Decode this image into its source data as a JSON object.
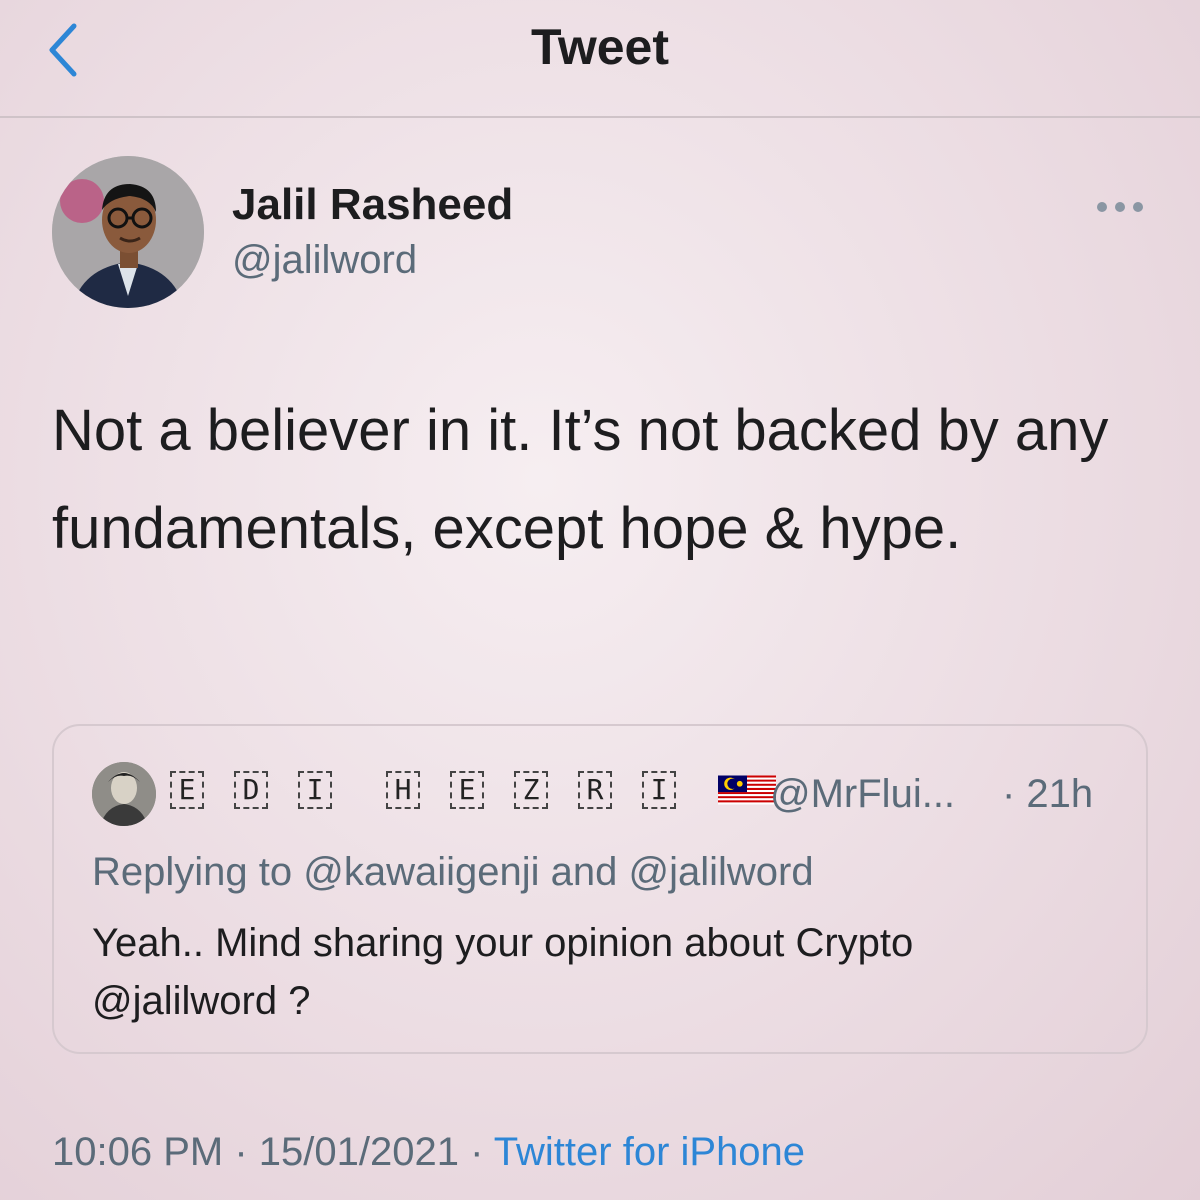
{
  "nav": {
    "title": "Tweet",
    "back_icon": "chevron-left-icon"
  },
  "tweet": {
    "author_name": "Jalil Rasheed",
    "author_handle": "@jalilword",
    "more_icon": "ellipsis-icon",
    "text": "Not a believer in it. It’s not backed by any fundamentals, except hope & hype.",
    "time": "10:06 PM",
    "date": "15/01/2021",
    "separator": " · ",
    "source": "Twitter for iPhone"
  },
  "quote": {
    "name_letters": [
      "E",
      "D",
      "I",
      "H",
      "E",
      "Z",
      "R",
      "I"
    ],
    "flag": "malaysia-flag",
    "handle": "@MrFlui...",
    "time": "· 21h",
    "reply_line": "Replying to @kawaiigenji and @jalilword",
    "text": "Yeah.. Mind sharing your opinion about Crypto @jalilword ?"
  },
  "colors": {
    "accent": "#2d86d6",
    "muted": "#5b6b79",
    "background": "#efe2e7"
  }
}
